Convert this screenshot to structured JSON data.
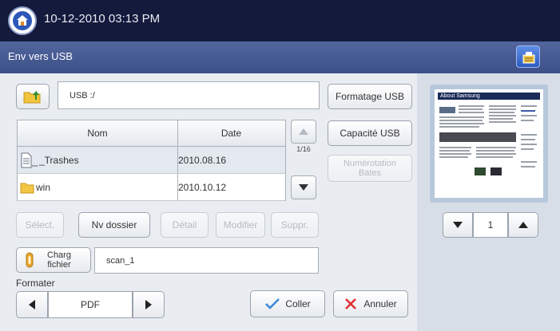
{
  "status_bar": {
    "datetime": "10-12-2010 03:13 PM",
    "home_icon": "home-icon"
  },
  "header": {
    "title": "Env vers USB",
    "job_icon": "job-status-icon"
  },
  "path": {
    "up_icon": "folder-up-icon",
    "value": "USB :/"
  },
  "actions_right": {
    "format_usb": "Formatage USB",
    "capacity_usb": "Capacité USB",
    "bates_numbering": "Numérotation Bates"
  },
  "file_table": {
    "columns": [
      "Nom",
      "Date"
    ],
    "rows": [
      {
        "name": "_Trashes",
        "date": "2010.08.16",
        "icon": "file-icon"
      },
      {
        "name": "win",
        "date": "2010.10.12",
        "icon": "folder-icon"
      }
    ],
    "page_indicator": "1/16"
  },
  "file_actions": {
    "select": "Sélect.",
    "new_folder": "Nv dossier",
    "detail": "Détail",
    "modify": "Modifier",
    "delete": "Suppr."
  },
  "filename": {
    "button_line1": "Charg",
    "button_line2": "fichier",
    "value": "scan_1"
  },
  "format": {
    "label": "Formater",
    "value": "PDF"
  },
  "bottom_actions": {
    "paste": "Coller",
    "cancel": "Annuler"
  },
  "preview": {
    "page": "1",
    "doc_title": "About Samsung"
  }
}
